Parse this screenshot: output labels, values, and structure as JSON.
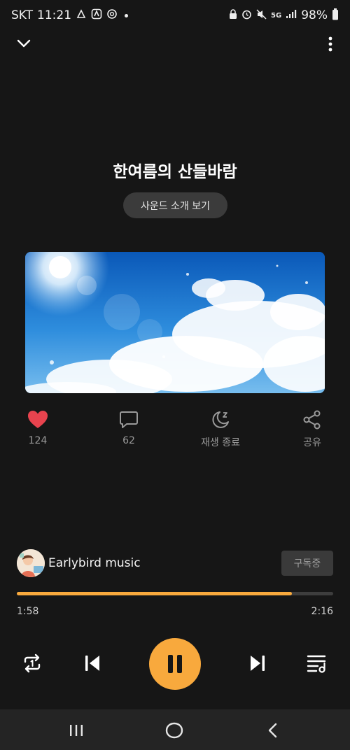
{
  "status_bar": {
    "carrier": "SKT",
    "time": "11:21",
    "network": "5G",
    "battery": "98%"
  },
  "player": {
    "title": "한여름의 산들바람",
    "intro_button": "사운드 소개 보기",
    "artwork_icon": "sky-clouds-artwork"
  },
  "actions": {
    "like": {
      "label": "124",
      "icon": "heart-icon",
      "color": "#e8434e"
    },
    "comment": {
      "label": "62",
      "icon": "comment-icon"
    },
    "sleep_timer": {
      "label": "재생 종료",
      "icon": "moon-icon"
    },
    "share": {
      "label": "공유",
      "icon": "share-icon"
    }
  },
  "artist": {
    "name": "Earlybird music",
    "subscribe_label": "구독중"
  },
  "progress": {
    "elapsed": "1:58",
    "total": "2:16",
    "fraction": 0.87,
    "accent": "#f8a93d"
  },
  "controls": [
    "repeat-icon",
    "previous-icon",
    "pause-icon",
    "next-icon",
    "playlist-icon"
  ],
  "nav": [
    "recent-apps-icon",
    "home-icon",
    "back-icon"
  ]
}
